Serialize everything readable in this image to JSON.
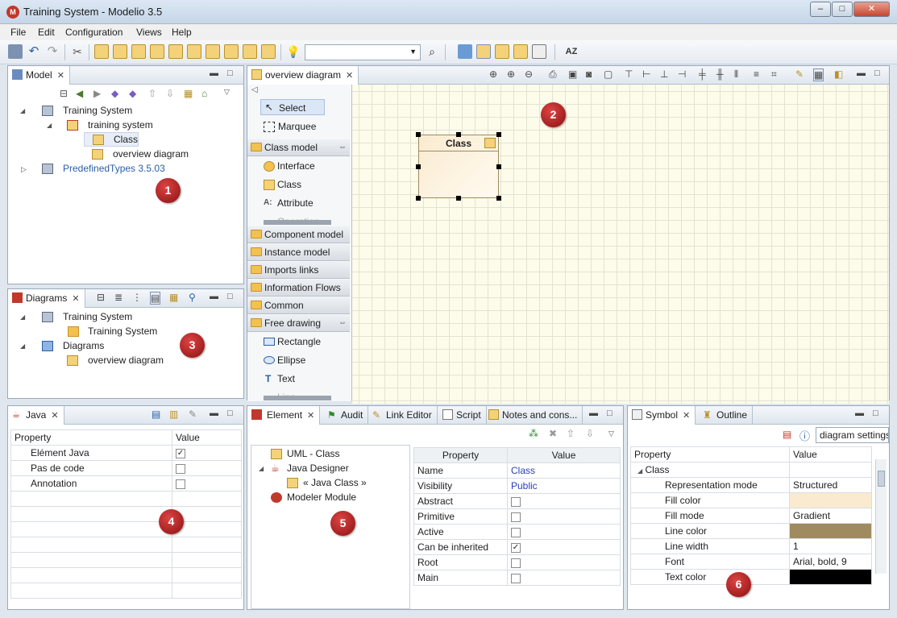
{
  "window": {
    "title": "Training System - Modelio 3.5",
    "minimize": "–",
    "maximize": "□",
    "close": "✕"
  },
  "menu": [
    "File",
    "Edit",
    "Configuration",
    "Views",
    "Help"
  ],
  "model_panel": {
    "tab": "Model",
    "tree": [
      {
        "label": "Training System"
      },
      {
        "label": "training system"
      },
      {
        "label": "Class"
      },
      {
        "label": "overview diagram"
      },
      {
        "label": "PredefinedTypes 3.5.03"
      }
    ],
    "badge": "1"
  },
  "diagram_editor": {
    "tab": "overview diagram",
    "palette": {
      "select": "Select",
      "marquee": "Marquee",
      "class_model": "Class model",
      "interface": "Interface",
      "class": "Class",
      "attribute": "Attribute",
      "operation": "Operation",
      "groups": [
        "Component model",
        "Instance model",
        "Imports links",
        "Information Flows",
        "Common"
      ],
      "free_drawing": "Free drawing",
      "rectangle": "Rectangle",
      "ellipse": "Ellipse",
      "text": "Text",
      "line": "Line"
    },
    "class_box_label": "Class",
    "badge": "2"
  },
  "diagrams_panel": {
    "tab": "Diagrams",
    "tree": [
      {
        "label": "Training System"
      },
      {
        "label": "Training System"
      },
      {
        "label": "Diagrams"
      },
      {
        "label": "overview diagram"
      }
    ],
    "badge": "3"
  },
  "java_panel": {
    "tab": "Java",
    "headers": [
      "Property",
      "Value"
    ],
    "rows": [
      {
        "property": "Elément Java",
        "checked": true
      },
      {
        "property": "Pas de code",
        "checked": false
      },
      {
        "property": "Annotation",
        "checked": false
      }
    ],
    "badge": "4"
  },
  "element_panel": {
    "tabs": [
      "Element",
      "Audit",
      "Link Editor",
      "Script",
      "Notes and cons..."
    ],
    "tree": [
      {
        "label": "UML - Class"
      },
      {
        "label": "Java Designer"
      },
      {
        "label": "« Java Class »"
      },
      {
        "label": "Modeler Module"
      }
    ],
    "headers": [
      "Property",
      "Value"
    ],
    "rows": [
      {
        "property": "Name",
        "value": "Class"
      },
      {
        "property": "Visibility",
        "value": "Public"
      },
      {
        "property": "Abstract",
        "checked": false
      },
      {
        "property": "Primitive",
        "checked": false
      },
      {
        "property": "Active",
        "checked": false
      },
      {
        "property": "Can be inherited",
        "checked": true
      },
      {
        "property": "Root",
        "checked": false
      },
      {
        "property": "Main",
        "checked": false
      }
    ],
    "badge": "5"
  },
  "symbol_panel": {
    "tabs": [
      "Symbol",
      "Outline"
    ],
    "settings_combo": "diagram settings",
    "headers": [
      "Property",
      "Value"
    ],
    "group": "Class",
    "rows": [
      {
        "property": "Representation mode",
        "value": "Structured"
      },
      {
        "property": "Fill color",
        "value": "",
        "color": "#faebd0"
      },
      {
        "property": "Fill mode",
        "value": "Gradient"
      },
      {
        "property": "Line color",
        "value": "",
        "color": "#a08a60"
      },
      {
        "property": "Line width",
        "value": "1"
      },
      {
        "property": "Font",
        "value": "Arial, bold, 9"
      },
      {
        "property": "Text color",
        "value": "",
        "color": "#000000"
      }
    ],
    "badge": "6"
  }
}
